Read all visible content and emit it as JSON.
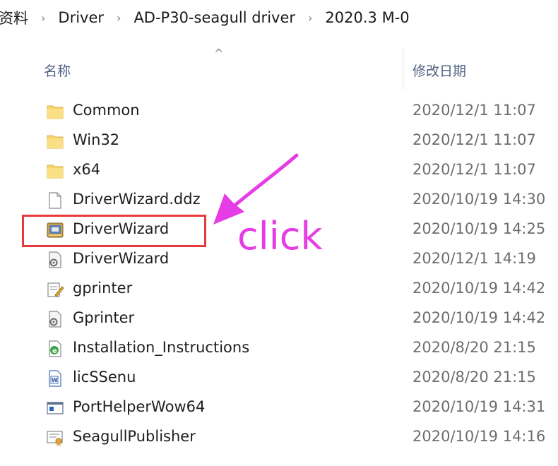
{
  "breadcrumb": {
    "items": [
      "资料",
      "Driver",
      "AD-P30-seagull driver",
      "2020.3 M-0"
    ],
    "separator": "›"
  },
  "header": {
    "name_label": "名称",
    "date_label": "修改日期",
    "sort_glyph": "^"
  },
  "files": [
    {
      "name": "Common",
      "date": "2020/12/1 11:07",
      "icon": "folder-icon"
    },
    {
      "name": "Win32",
      "date": "2020/12/1 11:07",
      "icon": "folder-icon"
    },
    {
      "name": "x64",
      "date": "2020/12/1 11:07",
      "icon": "folder-icon"
    },
    {
      "name": "DriverWizard.ddz",
      "date": "2020/10/19 14:30",
      "icon": "blank-file-icon"
    },
    {
      "name": "DriverWizard",
      "date": "2020/10/19 14:25",
      "icon": "installer-app-icon"
    },
    {
      "name": "DriverWizard",
      "date": "2020/12/1 14:19",
      "icon": "settings-file-icon"
    },
    {
      "name": "gprinter",
      "date": "2020/10/19 14:42",
      "icon": "text-config-icon"
    },
    {
      "name": "Gprinter",
      "date": "2020/10/19 14:42",
      "icon": "settings-file-icon"
    },
    {
      "name": "Installation_Instructions",
      "date": "2020/8/20 21:15",
      "icon": "html-document-icon"
    },
    {
      "name": "licSSenu",
      "date": "2020/8/20 21:15",
      "icon": "word-document-icon"
    },
    {
      "name": "PortHelperWow64",
      "date": "2020/10/19 14:31",
      "icon": "application-window-icon"
    },
    {
      "name": "SeagullPublisher",
      "date": "2020/10/19 14:16",
      "icon": "certificate-icon"
    }
  ],
  "annotation": {
    "label": "click",
    "highlight_color": "#e83a3a",
    "label_color": "#e63ce6"
  },
  "colors": {
    "folder": "#f6d36b",
    "header_text": "#4d6082",
    "date_text": "#6d6d6d"
  }
}
